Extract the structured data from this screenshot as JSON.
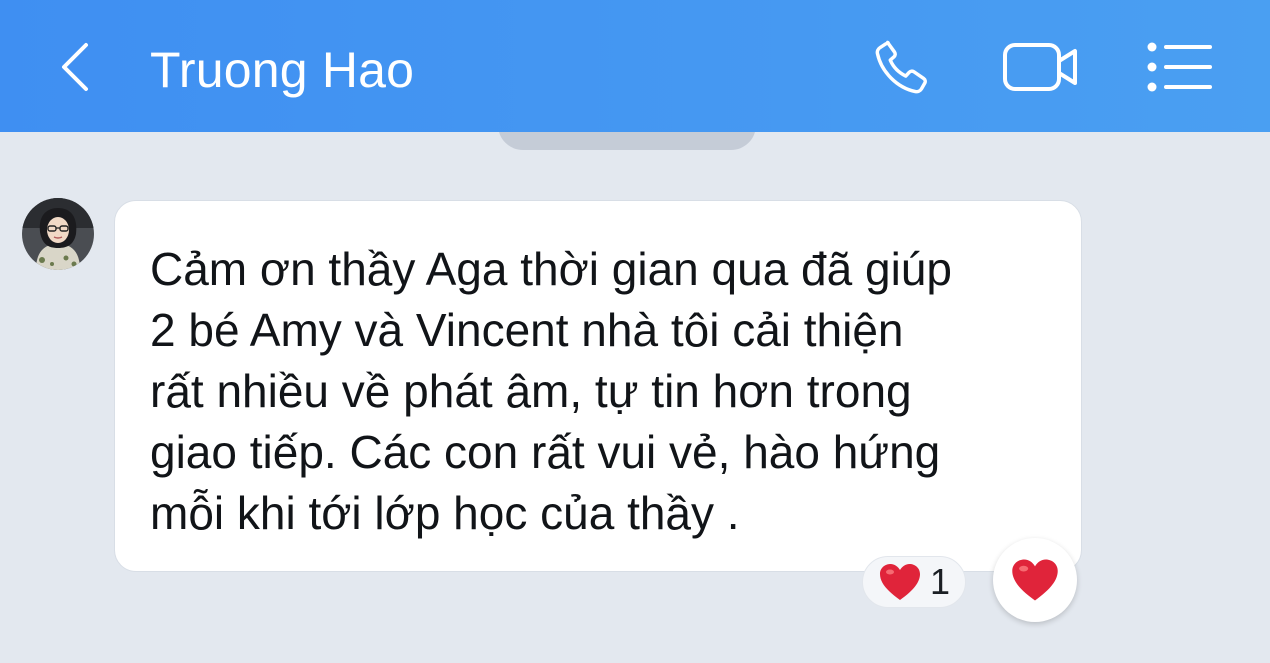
{
  "header": {
    "title": "Truong Hao",
    "back_icon": "chevron-left-icon",
    "call_icon": "phone-icon",
    "video_icon": "video-camera-icon",
    "menu_icon": "list-menu-icon",
    "background": "#4196f2",
    "text_color": "#ffffff"
  },
  "message": {
    "text": "Cảm ơn thầy Aga thời gian qua đã giúp\n2 bé  Amy và Vincent nhà tôi cải thiện\nrất nhiều về phát âm, tự tin hơn trong\ngiao tiếp. Các con rất vui vẻ, hào hứng\nmỗi khi tới lớp học của thầy ."
  },
  "reactions": {
    "emoji": "❤️",
    "count": "1",
    "react_button_emoji": "❤️"
  },
  "colors": {
    "chat_background": "#e3e8ef",
    "bubble": "#ffffff",
    "heart": "#e0243a"
  }
}
